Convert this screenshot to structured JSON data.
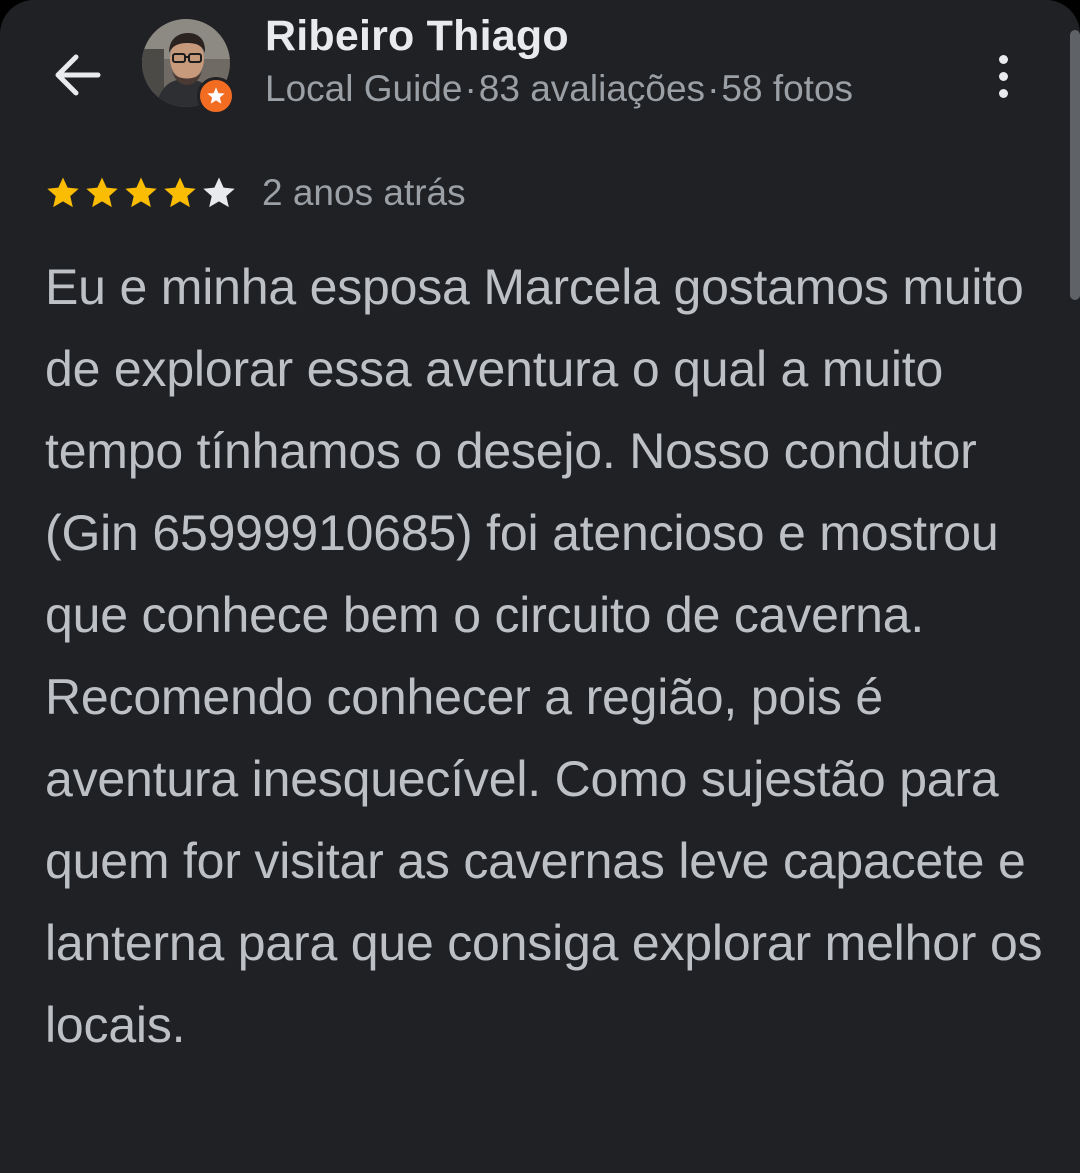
{
  "header": {
    "back_icon": "arrow-back-icon",
    "author_name": "Ribeiro Thiago",
    "author_meta": {
      "level": "Local Guide",
      "separator": "·",
      "reviews": "83 avaliações",
      "photos": "58 fotos"
    },
    "badge_icon": "local-guide-star-badge-icon",
    "menu_icon": "more-vertical-icon"
  },
  "review": {
    "rating": 4,
    "max_rating": 5,
    "date": "2 anos atrás",
    "text": "Eu e minha esposa Marcela gostamos muito de explorar essa aventura o qual a muito tempo tínhamos o desejo. Nosso condutor (Gin 65999910685) foi atencioso e mostrou que conhece bem o circuito de caverna. Recomendo conhecer a região, pois é aventura inesquecível. Como sujestão para quem for visitar as cavernas leve capacete e lanterna para que consiga explorar melhor os locais."
  },
  "colors": {
    "background": "#202124",
    "star_filled": "#fbbc04",
    "star_empty": "#e8eaed",
    "badge": "#f26d21",
    "primary_text": "#e8eaed",
    "secondary_text": "#9aa0a6",
    "body_text": "#bdc1c6"
  }
}
